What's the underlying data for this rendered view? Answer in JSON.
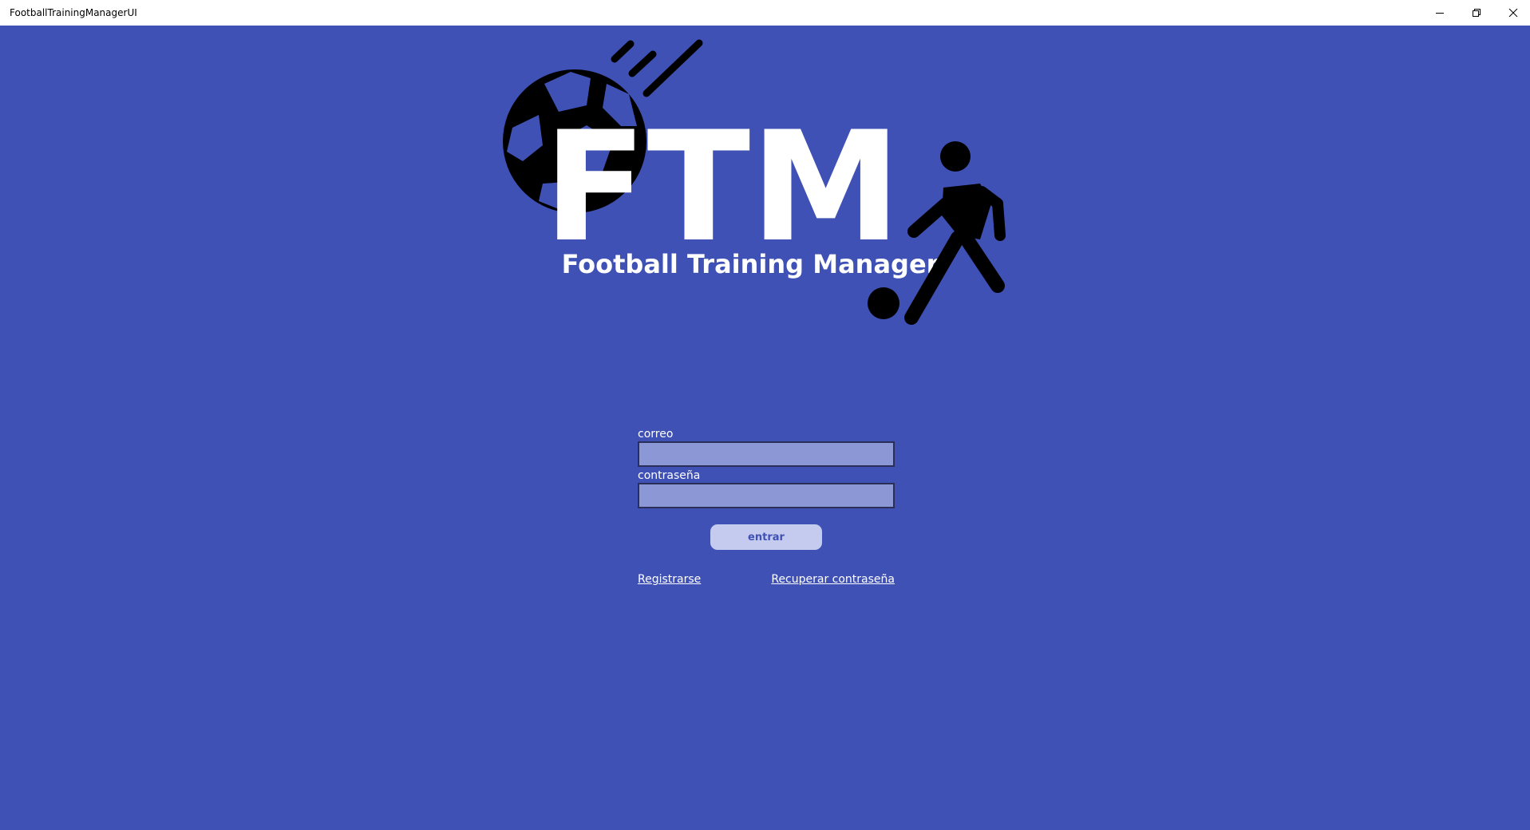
{
  "window": {
    "title": "FootballTrainingManagerUI",
    "controls": {
      "minimize_icon": "minimize-icon",
      "maximize_icon": "restore-icon",
      "close_icon": "close-icon"
    }
  },
  "logo": {
    "initials": "FTM",
    "tagline": "Football Training Manager"
  },
  "login": {
    "email_label": "correo",
    "email_value": "",
    "password_label": "contraseña",
    "password_value": "",
    "submit_label": "entrar",
    "register_link": "Registrarse",
    "recover_link": "Recuperar contraseña"
  },
  "colors": {
    "background": "#3f51b5",
    "input_fill": "#8c98d6",
    "button_fill": "#c5cbee",
    "button_text": "#3f51b5"
  }
}
